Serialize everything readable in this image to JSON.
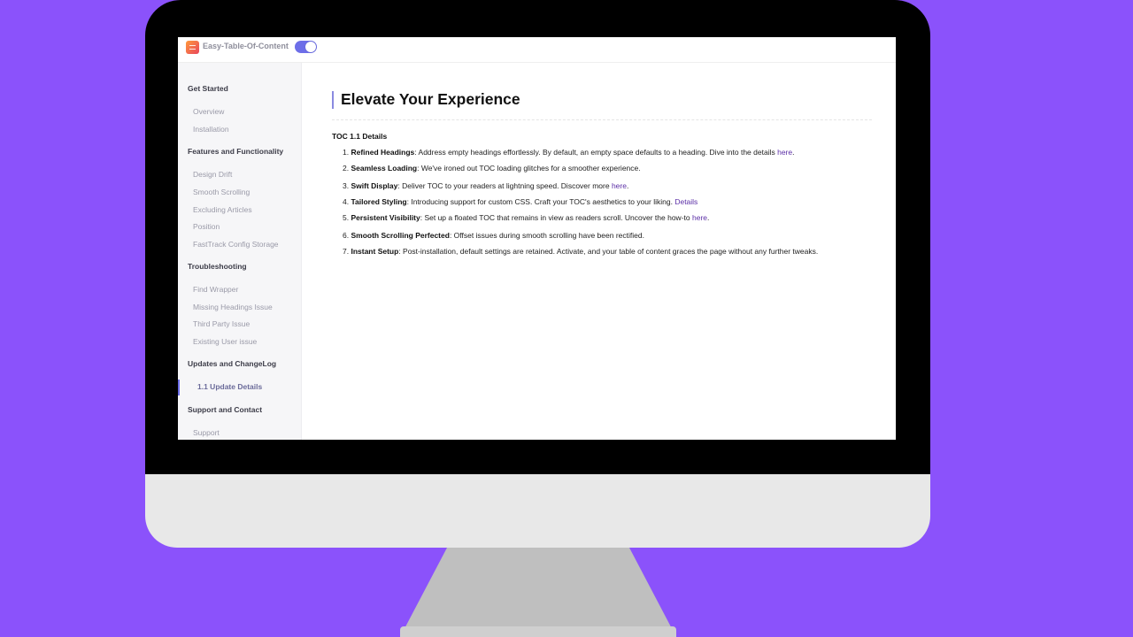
{
  "app": {
    "title": "Easy-Table-Of-Content",
    "toggle_on": true,
    "accent_color": "#6d6ee8",
    "background_color": "#8b52fb"
  },
  "sidebar": {
    "sections": [
      {
        "label": "Get Started",
        "items": [
          {
            "label": "Overview"
          },
          {
            "label": "Installation"
          }
        ]
      },
      {
        "label": "Features and Functionality",
        "items": [
          {
            "label": "Design Drift"
          },
          {
            "label": "Smooth Scrolling"
          },
          {
            "label": "Excluding Articles"
          },
          {
            "label": "Position"
          },
          {
            "label": "FastTrack Config Storage"
          }
        ]
      },
      {
        "label": "Troubleshooting",
        "items": [
          {
            "label": "Find Wrapper"
          },
          {
            "label": "Missing Headings Issue"
          },
          {
            "label": "Third Party Issue"
          },
          {
            "label": "Existing User issue"
          }
        ]
      },
      {
        "label": "Updates and ChangeLog",
        "items": [
          {
            "label": "1.1 Update Details",
            "active": true
          }
        ]
      },
      {
        "label": "Support and Contact",
        "items": [
          {
            "label": "Support"
          }
        ]
      }
    ]
  },
  "main": {
    "title": "Elevate Your Experience",
    "section_title": "TOC 1.1 Details",
    "items": [
      {
        "num": "1.",
        "bold": "Refined Headings",
        "text": ": Address empty headings effortlessly. By default, an empty space defaults to a heading. Dive into the details ",
        "link": "here",
        "after": "."
      },
      {
        "num": "2.",
        "bold": "Seamless Loading",
        "text": ": We've ironed out TOC loading glitches for a smoother experience.",
        "link": "",
        "after": ""
      },
      {
        "num": "3.",
        "bold": "Swift Display",
        "text": ": Deliver TOC to your readers at lightning speed. Discover more ",
        "link": "here",
        "after": "."
      },
      {
        "num": "4.",
        "bold": "Tailored Styling",
        "text": ": Introducing support for custom CSS. Craft your TOC's aesthetics to your liking. ",
        "link": "Details",
        "after": ""
      },
      {
        "num": "5.",
        "bold": "Persistent Visibility",
        "text": ": Set up a floated TOC that remains in view as readers scroll. Uncover the how-to ",
        "link": "here",
        "after": "."
      },
      {
        "num": "6.",
        "bold": "Smooth Scrolling Perfected",
        "text": ": Offset issues during smooth scrolling have been rectified.",
        "link": "",
        "after": ""
      },
      {
        "num": "7.",
        "bold": "Instant Setup",
        "text": ": Post-installation, default settings are retained. Activate, and your table of content graces the page without any further tweaks.",
        "link": "",
        "after": ""
      }
    ]
  }
}
